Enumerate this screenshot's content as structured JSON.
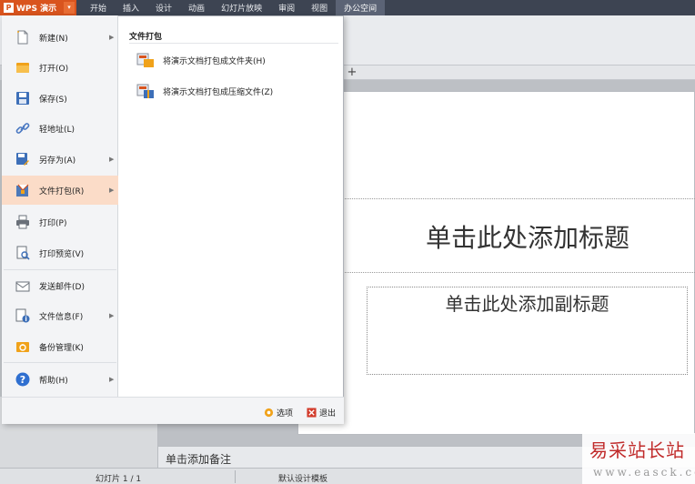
{
  "app": {
    "name": "WPS 演示",
    "logo": "P"
  },
  "menubar": {
    "tabs": [
      "开始",
      "插入",
      "设计",
      "动画",
      "幻灯片放映",
      "审阅",
      "视图",
      "办公空间"
    ],
    "active_index": 7
  },
  "file_menu": {
    "items": [
      {
        "label": "新建(N)",
        "icon": "new-document-icon",
        "submenu": true
      },
      {
        "label": "打开(O)",
        "icon": "open-folder-icon",
        "submenu": false
      },
      {
        "label": "保存(S)",
        "icon": "save-disk-icon",
        "submenu": false
      },
      {
        "label": "轻地址(L)",
        "icon": "link-icon",
        "submenu": false
      },
      {
        "label": "另存为(A)",
        "icon": "save-as-icon",
        "submenu": true
      },
      {
        "label": "文件打包(R)",
        "icon": "package-icon",
        "submenu": true
      },
      {
        "label": "打印(P)",
        "icon": "printer-icon",
        "submenu": false
      },
      {
        "label": "打印预览(V)",
        "icon": "print-preview-icon",
        "submenu": false
      },
      {
        "label": "发送邮件(D)",
        "icon": "mail-icon",
        "submenu": false
      },
      {
        "label": "文件信息(F)",
        "icon": "file-info-icon",
        "submenu": true
      },
      {
        "label": "备份管理(K)",
        "icon": "backup-icon",
        "submenu": false
      },
      {
        "label": "帮助(H)",
        "icon": "help-icon",
        "submenu": true
      }
    ],
    "highlighted": "文件打包(R)"
  },
  "submenu": {
    "title": "文件打包",
    "items": [
      {
        "label": "将演示文档打包成文件夹(H)",
        "icon": "package-folder-icon"
      },
      {
        "label": "将演示文档打包成压缩文件(Z)",
        "icon": "package-zip-icon"
      }
    ]
  },
  "footer": {
    "options_label": "选项",
    "exit_label": "退出"
  },
  "slide": {
    "title_placeholder": "单击此处添加标题",
    "subtitle_placeholder": "单击此处添加副标题"
  },
  "notes": {
    "placeholder": "单击添加备注"
  },
  "status": {
    "slide_counter": "幻灯片 1 / 1",
    "template": "默认设计模板"
  },
  "watermark": {
    "cn": "易采站长站",
    "url": "www.easck.com"
  },
  "colors": {
    "app_orange": "#d9541e",
    "menubar": "#3d4452",
    "highlight": "#fbdcc8",
    "exit_red": "#d23b2b"
  }
}
